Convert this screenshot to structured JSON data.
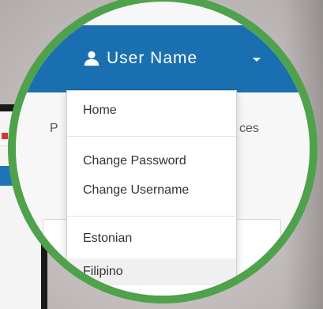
{
  "header": {
    "user_name": "User Name"
  },
  "background": {
    "left_fragment": "P",
    "right_fragment": "ces"
  },
  "user_menu": {
    "items": [
      {
        "label": "Home"
      },
      {
        "label": "Change Password"
      },
      {
        "label": "Change Username"
      },
      {
        "label": "Estonian"
      },
      {
        "label": "Filipino"
      }
    ]
  },
  "colors": {
    "navbar": "#1a6fb0",
    "lens_border": "#4fa24b",
    "hover_item": "#f0f0f0"
  },
  "icons": {
    "user": "user-icon",
    "caret": "caret-down-icon"
  }
}
